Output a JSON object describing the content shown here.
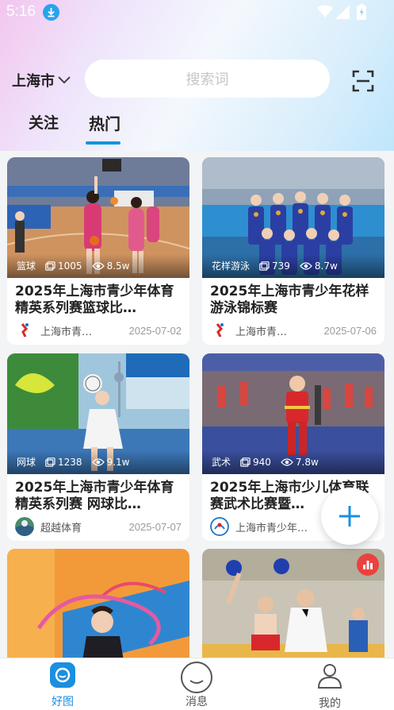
{
  "status_bar": {
    "time": "5:16"
  },
  "header": {
    "city": "上海市",
    "search_placeholder": "搜索词"
  },
  "tabs": [
    {
      "label": "关注"
    },
    {
      "label": "热门"
    }
  ],
  "cards": [
    {
      "category": "篮球",
      "photos": "1005",
      "views": "8.5w",
      "title": "2025年上海市青少年体育精英系列赛篮球比…",
      "author": "上海市青…",
      "date": "2025-07-02"
    },
    {
      "category": "花样游泳",
      "photos": "739",
      "views": "8.7w",
      "title": "2025年上海市青少年花样游泳锦标赛",
      "author": "上海市青…",
      "date": "2025-07-06"
    },
    {
      "category": "网球",
      "photos": "1238",
      "views": "9.1w",
      "title": "2025年上海市青少年体育精英系列赛 网球比…",
      "author": "超越体育",
      "date": "2025-07-07"
    },
    {
      "category": "武术",
      "photos": "940",
      "views": "7.8w",
      "title": "2025年上海市少儿体育联赛武术比赛暨…",
      "author": "上海市青少年…",
      "date": ""
    },
    {
      "category": "",
      "photos": "",
      "views": "",
      "title": "",
      "author": "",
      "date": ""
    },
    {
      "category": "",
      "photos": "",
      "views": "",
      "title": "",
      "author": "",
      "date": ""
    }
  ],
  "bottom_nav": [
    {
      "label": "好图"
    },
    {
      "label": "消息"
    },
    {
      "label": "我的"
    }
  ],
  "colors": {
    "accent": "#1296db",
    "nav_active": "#1b8fe0",
    "badge": "#e9423f"
  }
}
